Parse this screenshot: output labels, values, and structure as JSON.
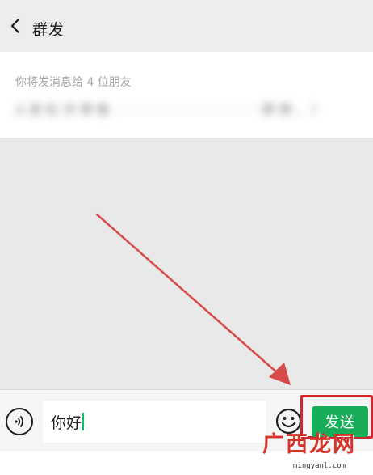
{
  "header": {
    "back_icon": "chevron-left-icon",
    "title": "群发"
  },
  "recipients": {
    "count_text": "你将发消息给 4 位朋友",
    "names_text": "A 潇 松 洋 博 春 ·  ·  ·  ·  ·  ·  ·  ·  ·  ·  ·  ·  ·  ·  ·  ·  ·  · 博 博 、 阿 长"
  },
  "input_bar": {
    "voice_icon": "voice-icon",
    "message_value": "你好",
    "emoji_icon": "emoji-icon",
    "send_label": "发送"
  },
  "watermark": {
    "logo_text": "广西龙网",
    "url_text": "mingyanl.com"
  },
  "colors": {
    "accent_green": "#19ad5a",
    "annotation_red": "#d0262d"
  }
}
